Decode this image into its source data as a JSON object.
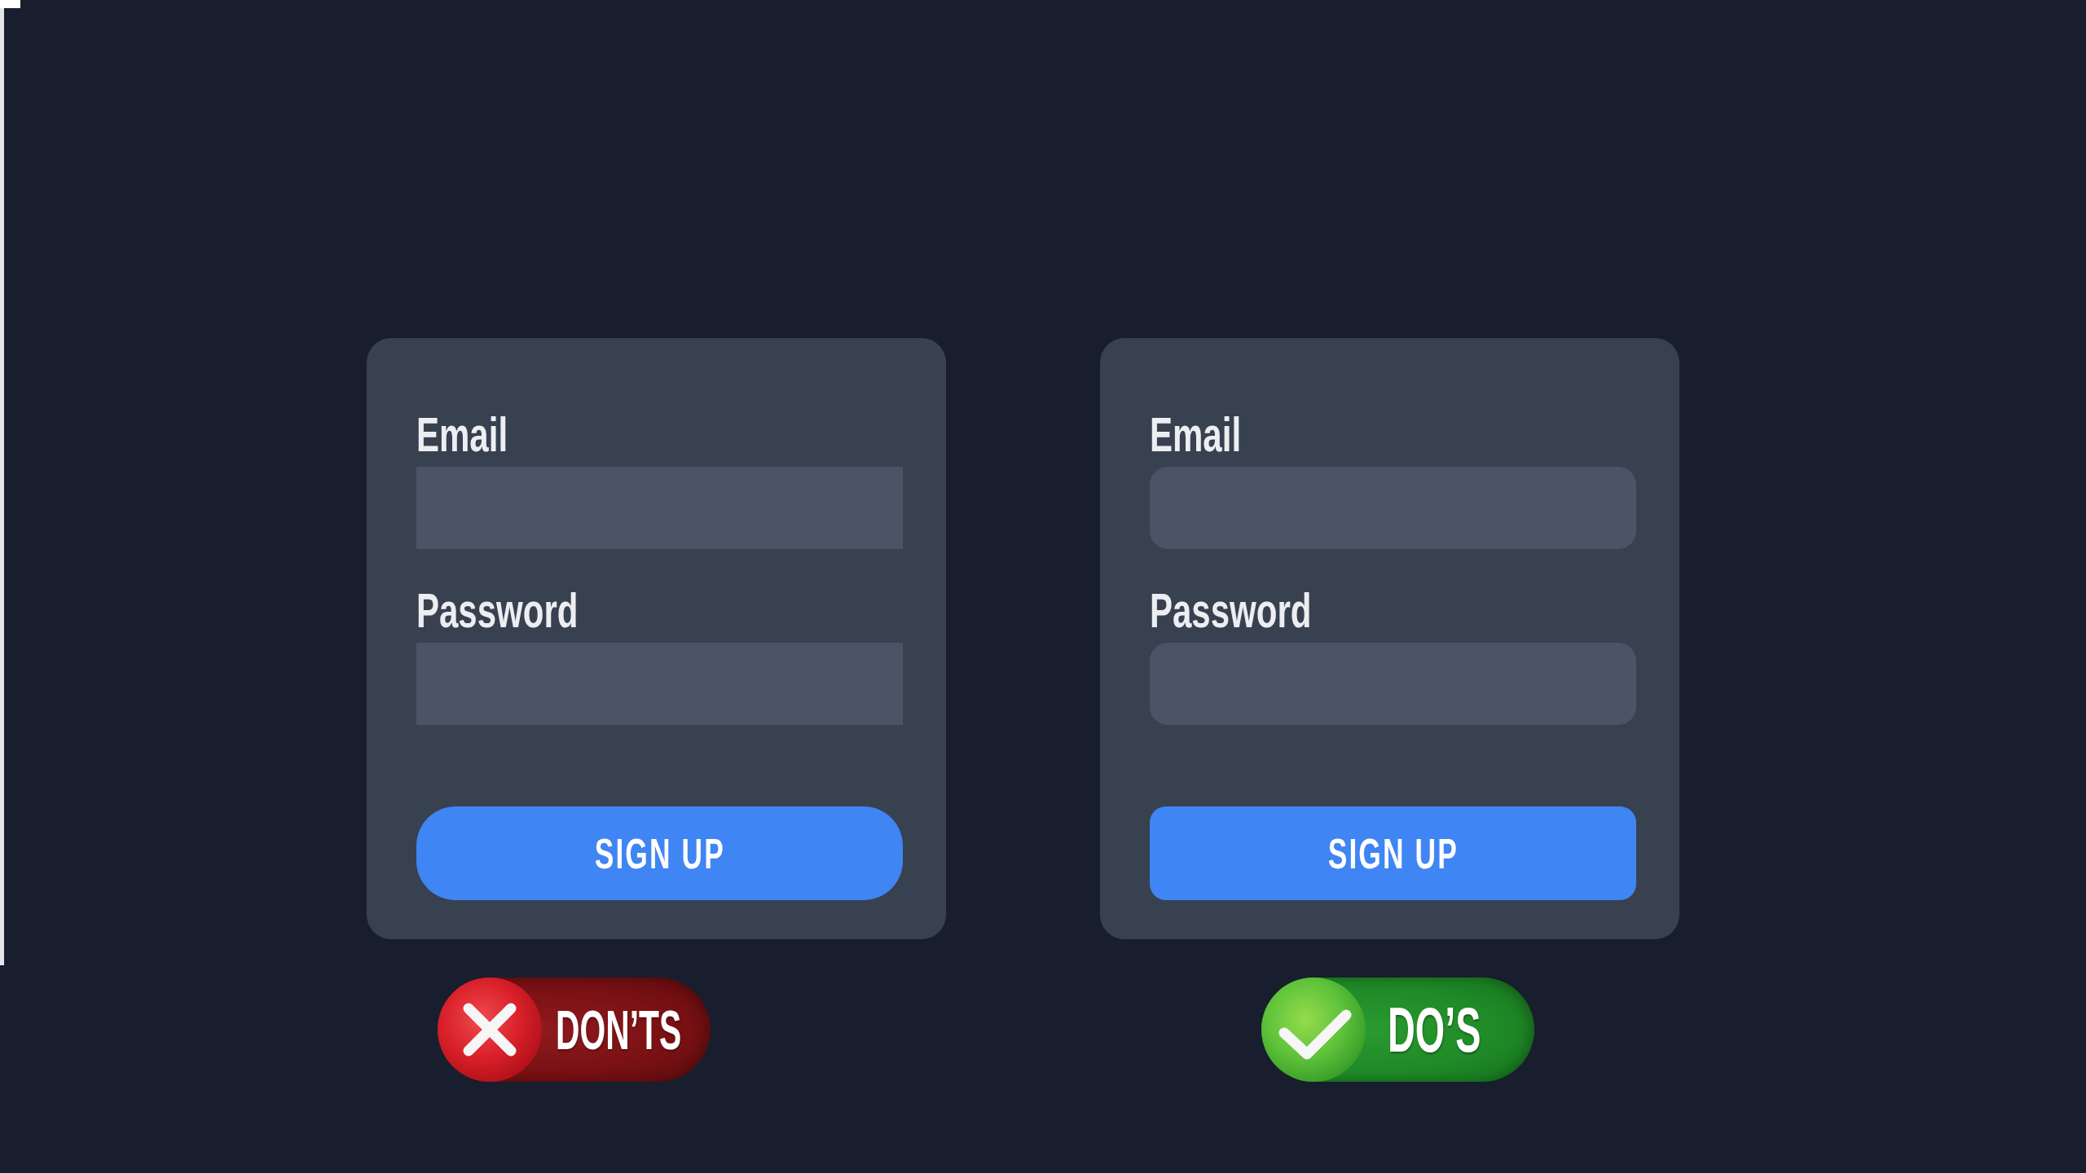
{
  "comparisons": [
    {
      "form": {
        "kind": "mixed",
        "fields": [
          {
            "label": "Email"
          },
          {
            "label": "Password"
          }
        ],
        "button": "SIGN UP"
      },
      "verdict": {
        "kind": "dont",
        "label": "DON’TS"
      }
    },
    {
      "form": {
        "kind": "uniform",
        "fields": [
          {
            "label": "Email"
          },
          {
            "label": "Password"
          }
        ],
        "button": "SIGN UP"
      },
      "verdict": {
        "kind": "do",
        "label": "DO’S"
      }
    }
  ]
}
